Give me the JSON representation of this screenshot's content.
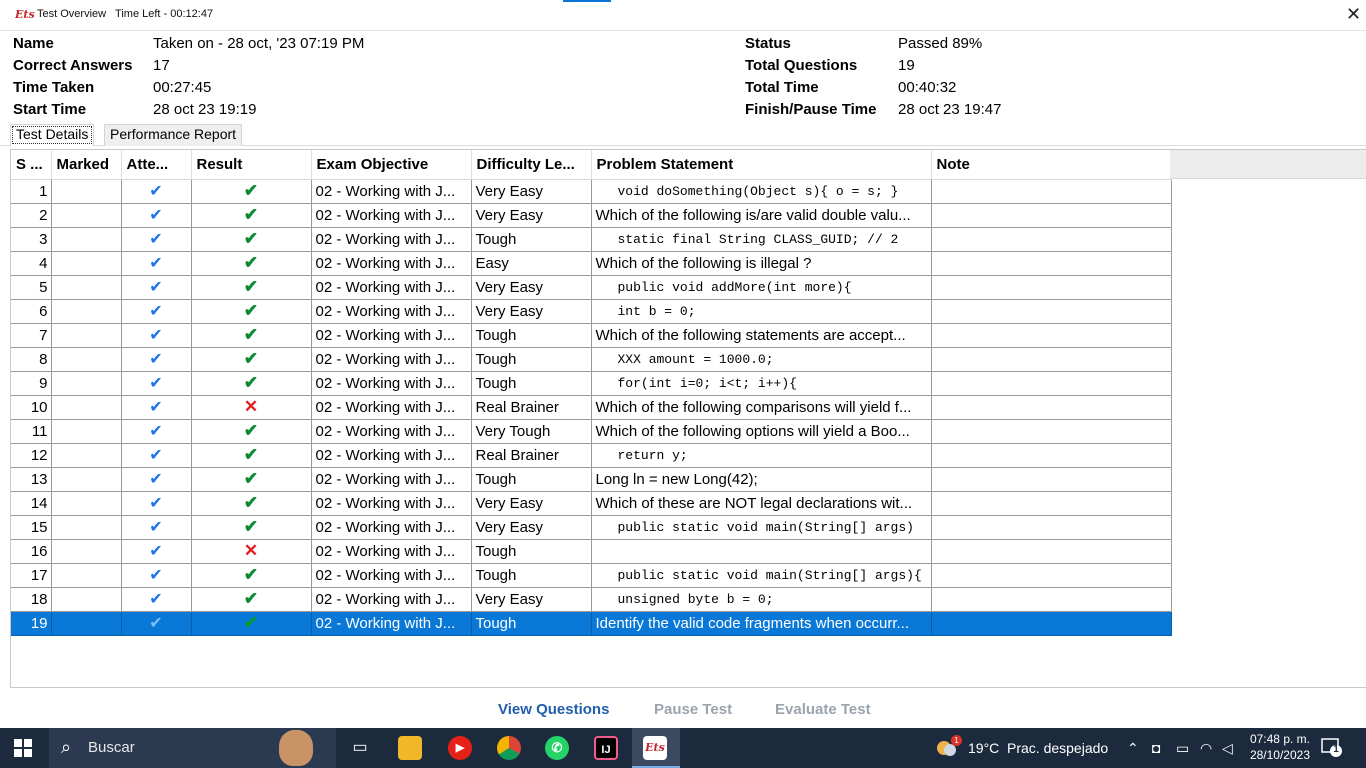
{
  "window": {
    "logo": "Ets",
    "title": "Test Overview   Time Left - 00:12:47",
    "close_symbol": "✕"
  },
  "summary": {
    "name_label": "Name",
    "name_value": "Taken on - 28 oct, '23 07:19 PM",
    "correct_label": "Correct Answers",
    "correct_value": "17",
    "time_taken_label": "Time Taken",
    "time_taken_value": "00:27:45",
    "start_label": "Start Time",
    "start_value": "28 oct 23 19:19",
    "status_label": "Status",
    "status_value": "Passed 89%",
    "total_q_label": "Total Questions",
    "total_q_value": "19",
    "total_time_label": "Total Time",
    "total_time_value": "00:40:32",
    "finish_label": "Finish/Pause Time",
    "finish_value": "28 oct 23 19:47"
  },
  "tabs": [
    {
      "label": "Test Details",
      "active": true
    },
    {
      "label": "Performance Report",
      "active": false
    }
  ],
  "table": {
    "headers": [
      "S ...",
      "Marked",
      "Atte...",
      "Result",
      "Exam Objective",
      "Difficulty Le...",
      "Problem Statement",
      "Note"
    ],
    "rows": [
      {
        "sn": "1",
        "marked": "",
        "attempted": "tick",
        "result": "correct",
        "objective": "02 - Working with J...",
        "difficulty": "Very Easy",
        "problem": "void doSomething(Object s){  o = s;   }",
        "code": true,
        "note": ""
      },
      {
        "sn": "2",
        "marked": "",
        "attempted": "tick",
        "result": "correct",
        "objective": "02 - Working with J...",
        "difficulty": "Very Easy",
        "problem": "Which of the following is/are valid double valu...",
        "code": false,
        "note": ""
      },
      {
        "sn": "3",
        "marked": "",
        "attempted": "tick",
        "result": "correct",
        "objective": "02 - Working with J...",
        "difficulty": "Tough",
        "problem": "static final String CLASS_GUID;   // 2",
        "code": true,
        "note": ""
      },
      {
        "sn": "4",
        "marked": "",
        "attempted": "tick",
        "result": "correct",
        "objective": "02 - Working with J...",
        "difficulty": "Easy",
        "problem": "Which of the following is illegal ?",
        "code": false,
        "note": ""
      },
      {
        "sn": "5",
        "marked": "",
        "attempted": "tick",
        "result": "correct",
        "objective": "02 - Working with J...",
        "difficulty": "Very Easy",
        "problem": "public void addMore(int more){",
        "code": true,
        "note": ""
      },
      {
        "sn": "6",
        "marked": "",
        "attempted": "tick",
        "result": "correct",
        "objective": "02 - Working with J...",
        "difficulty": "Very Easy",
        "problem": "int b = 0;",
        "code": true,
        "note": ""
      },
      {
        "sn": "7",
        "marked": "",
        "attempted": "tick",
        "result": "correct",
        "objective": "02 - Working with J...",
        "difficulty": "Tough",
        "problem": "Which of the following statements are accept...",
        "code": false,
        "note": ""
      },
      {
        "sn": "8",
        "marked": "",
        "attempted": "tick",
        "result": "correct",
        "objective": "02 - Working with J...",
        "difficulty": "Tough",
        "problem": "XXX amount = 1000.0;",
        "code": true,
        "note": ""
      },
      {
        "sn": "9",
        "marked": "",
        "attempted": "tick",
        "result": "correct",
        "objective": "02 - Working with J...",
        "difficulty": "Tough",
        "problem": "for(int i=0; i<t; i++){",
        "code": true,
        "note": ""
      },
      {
        "sn": "10",
        "marked": "",
        "attempted": "tick",
        "result": "wrong",
        "objective": "02 - Working with J...",
        "difficulty": "Real Brainer",
        "problem": "Which of the following comparisons will yield f...",
        "code": false,
        "note": ""
      },
      {
        "sn": "11",
        "marked": "",
        "attempted": "tick",
        "result": "correct",
        "objective": "02 - Working with J...",
        "difficulty": "Very Tough",
        "problem": "Which of the following options will yield a Boo...",
        "code": false,
        "note": ""
      },
      {
        "sn": "12",
        "marked": "",
        "attempted": "tick",
        "result": "correct",
        "objective": "02 - Working with J...",
        "difficulty": "Real Brainer",
        "problem": "return y;",
        "code": true,
        "note": ""
      },
      {
        "sn": "13",
        "marked": "",
        "attempted": "tick",
        "result": "correct",
        "objective": "02 - Working with J...",
        "difficulty": "Tough",
        "problem": "Long ln = new Long(42);",
        "code": "plain",
        "note": ""
      },
      {
        "sn": "14",
        "marked": "",
        "attempted": "tick",
        "result": "correct",
        "objective": "02 - Working with J...",
        "difficulty": "Very Easy",
        "problem": "Which of these are NOT legal declarations wit...",
        "code": false,
        "note": ""
      },
      {
        "sn": "15",
        "marked": "",
        "attempted": "tick",
        "result": "correct",
        "objective": "02 - Working with J...",
        "difficulty": "Very Easy",
        "problem": "public static void main(String[] args)",
        "code": true,
        "note": ""
      },
      {
        "sn": "16",
        "marked": "",
        "attempted": "tick",
        "result": "wrong",
        "objective": "02 - Working with J...",
        "difficulty": "Tough",
        "problem": "",
        "code": true,
        "note": ""
      },
      {
        "sn": "17",
        "marked": "",
        "attempted": "tick",
        "result": "correct",
        "objective": "02 - Working with J...",
        "difficulty": "Tough",
        "problem": "public static void main(String[] args){",
        "code": true,
        "note": ""
      },
      {
        "sn": "18",
        "marked": "",
        "attempted": "tick",
        "result": "correct",
        "objective": "02 - Working with J...",
        "difficulty": "Very Easy",
        "problem": "unsigned byte b = 0;",
        "code": true,
        "note": ""
      },
      {
        "sn": "19",
        "marked": "",
        "attempted": "tick",
        "result": "correct",
        "objective": "02 - Working with J...",
        "difficulty": "Tough",
        "problem": "Identify the valid code fragments when occurr...",
        "code": false,
        "note": "",
        "selected": true
      }
    ]
  },
  "actions": {
    "view_questions": "View Questions",
    "pause_test": "Pause Test",
    "evaluate_test": "Evaluate Test"
  },
  "taskbar": {
    "search_text": "Buscar",
    "weather_badge": "1",
    "weather_temp": "19°C",
    "weather_desc": "Prac. despejado",
    "time": "07:48 p. m.",
    "date": "28/10/2023",
    "notification_count": "1"
  },
  "colors": {
    "selection": "#0a78d7",
    "correct": "#0d8a2e",
    "wrong": "#e02020",
    "attempted": "#1a73e8",
    "link_primary": "#1f5fad",
    "taskbar": "#1c2a3d"
  }
}
